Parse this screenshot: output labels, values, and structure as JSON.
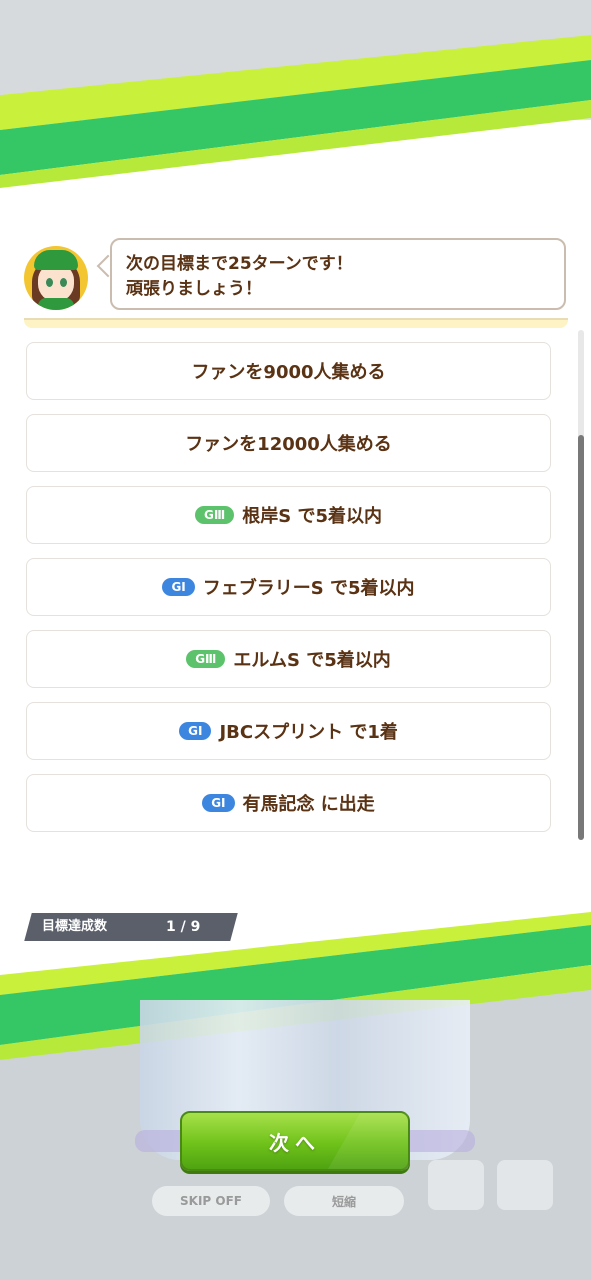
{
  "speech": {
    "line1": "次の目標まで25ターンです！",
    "line2": "頑張りましょう！"
  },
  "goals": [
    {
      "text": "ファンを9000人集める"
    },
    {
      "text": "ファンを12000人集める"
    },
    {
      "badge": "GⅢ",
      "badge_color": "#5cc26b",
      "text": "根岸S で5着以内"
    },
    {
      "badge": "GⅠ",
      "badge_color": "#3d86e0",
      "text": "フェブラリーS で5着以内"
    },
    {
      "badge": "GⅢ",
      "badge_color": "#5cc26b",
      "text": "エルムS で5着以内"
    },
    {
      "badge": "GⅠ",
      "badge_color": "#3d86e0",
      "text": "JBCスプリント で1着"
    },
    {
      "badge": "GⅠ",
      "badge_color": "#3d86e0",
      "text": "有馬記念 に出走"
    }
  ],
  "progress": {
    "label": "目標達成数",
    "value": "1 / 9"
  },
  "next_button": "次へ",
  "ghost_buttons": {
    "skip": "SKIP OFF",
    "log": "短縮"
  },
  "colors": {
    "accent_green": "#6fc21a",
    "text_brown": "#5a3214",
    "badge_g1": "#3d86e0",
    "badge_g3": "#5cc26b"
  }
}
